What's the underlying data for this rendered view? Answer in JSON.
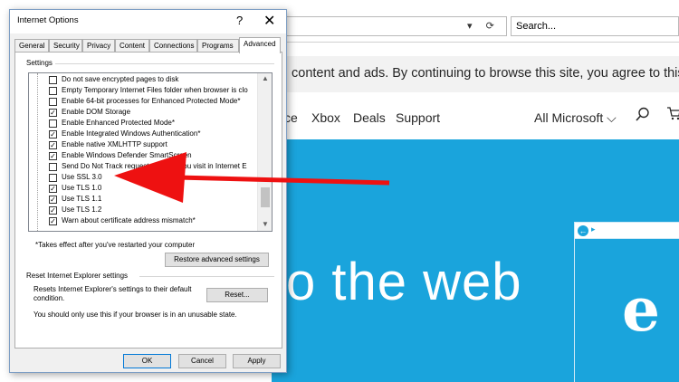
{
  "browser": {
    "search_placeholder": "Search...",
    "address_icons": "▾ ⟳",
    "cookie_notice": "content and ads. By continuing to browse this site, you agree to this use.",
    "nav": {
      "fragment": "ce",
      "xbox": "Xbox",
      "deals": "Deals",
      "support": "Support",
      "all_microsoft": "All Microsoft ⌵"
    },
    "hero_text": "o the web",
    "accent_color": "#1aa4dc"
  },
  "dialog": {
    "title": "Internet Options",
    "help": "?",
    "close": "✕",
    "tabs": [
      "General",
      "Security",
      "Privacy",
      "Content",
      "Connections",
      "Programs",
      "Advanced"
    ],
    "active_tab": "Advanced",
    "settings_label": "Settings",
    "settings_items": [
      {
        "label": "Do not save encrypted pages to disk",
        "checked": false
      },
      {
        "label": "Empty Temporary Internet Files folder when browser is clo",
        "checked": false
      },
      {
        "label": "Enable 64-bit processes for Enhanced Protected Mode*",
        "checked": false
      },
      {
        "label": "Enable DOM Storage",
        "checked": true
      },
      {
        "label": "Enable Enhanced Protected Mode*",
        "checked": false
      },
      {
        "label": "Enable Integrated Windows Authentication*",
        "checked": true
      },
      {
        "label": "Enable native XMLHTTP support",
        "checked": true
      },
      {
        "label": "Enable Windows Defender SmartScreen",
        "checked": true
      },
      {
        "label": "Send Do Not Track requests to sites you visit in Internet E",
        "checked": false
      },
      {
        "label": "Use SSL 3.0",
        "checked": false
      },
      {
        "label": "Use TLS 1.0",
        "checked": true
      },
      {
        "label": "Use TLS 1.1",
        "checked": true
      },
      {
        "label": "Use TLS 1.2",
        "checked": true
      },
      {
        "label": "Warn about certificate address mismatch*",
        "checked": true
      }
    ],
    "takes_effect_note": "*Takes effect after you've restarted your computer",
    "restore_button": "Restore advanced settings",
    "reset_group_label": "Reset Internet Explorer settings",
    "reset_description": "Resets Internet Explorer's settings to their default condition.",
    "reset_button": "Reset...",
    "unusable_note": "You should only use this if your browser is in an unusable state.",
    "ok_button": "OK",
    "cancel_button": "Cancel",
    "apply_button": "Apply"
  },
  "annotation": {
    "arrow_color": "#ee1111"
  }
}
